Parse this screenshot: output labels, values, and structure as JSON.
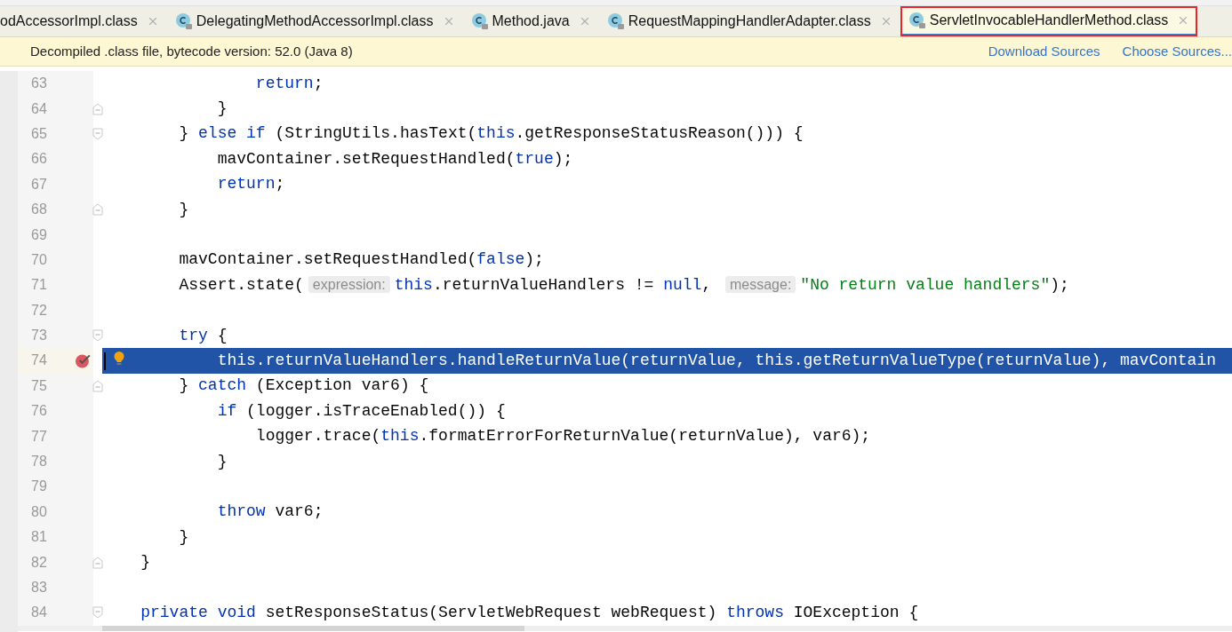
{
  "tabs": [
    {
      "label": "odAccessorImpl.class",
      "selected": false,
      "annotated": false,
      "icon": false
    },
    {
      "label": "DelegatingMethodAccessorImpl.class",
      "selected": false,
      "annotated": false,
      "icon": true
    },
    {
      "label": "Method.java",
      "selected": false,
      "annotated": false,
      "icon": true
    },
    {
      "label": "RequestMappingHandlerAdapter.class",
      "selected": false,
      "annotated": false,
      "icon": true
    },
    {
      "label": "ServletInvocableHandlerMethod.class",
      "selected": true,
      "annotated": true,
      "icon": true
    }
  ],
  "notification": {
    "message": "Decompiled .class file, bytecode version: 52.0 (Java 8)",
    "links": [
      "Download Sources",
      "Choose Sources..."
    ]
  },
  "lines": [
    {
      "number": "63",
      "selected": false,
      "breakpoint": false,
      "fold_start": false,
      "fold_end": false,
      "tokens": [
        {
          "kind": "keyword",
          "text": "                return"
        },
        {
          "kind": "plain",
          "text": ";"
        }
      ]
    },
    {
      "number": "64",
      "selected": false,
      "breakpoint": false,
      "fold_start": false,
      "fold_end": true,
      "tokens": [
        {
          "kind": "plain",
          "text": "            }"
        }
      ]
    },
    {
      "number": "65",
      "selected": false,
      "breakpoint": false,
      "fold_start": true,
      "fold_end": false,
      "tokens": [
        {
          "kind": "plain",
          "text": "        } "
        },
        {
          "kind": "keyword",
          "text": "else if"
        },
        {
          "kind": "plain",
          "text": " (StringUtils.hasText("
        },
        {
          "kind": "keyword",
          "text": "this"
        },
        {
          "kind": "plain",
          "text": ".getResponseStatusReason())) {"
        }
      ]
    },
    {
      "number": "66",
      "selected": false,
      "breakpoint": false,
      "fold_start": false,
      "fold_end": false,
      "tokens": [
        {
          "kind": "plain",
          "text": "            mavContainer.setRequestHandled("
        },
        {
          "kind": "keyword",
          "text": "true"
        },
        {
          "kind": "plain",
          "text": ");"
        }
      ]
    },
    {
      "number": "67",
      "selected": false,
      "breakpoint": false,
      "fold_start": false,
      "fold_end": false,
      "tokens": [
        {
          "kind": "keyword",
          "text": "            return"
        },
        {
          "kind": "plain",
          "text": ";"
        }
      ]
    },
    {
      "number": "68",
      "selected": false,
      "breakpoint": false,
      "fold_start": false,
      "fold_end": true,
      "tokens": [
        {
          "kind": "plain",
          "text": "        }"
        }
      ]
    },
    {
      "number": "69",
      "selected": false,
      "breakpoint": false,
      "fold_start": false,
      "fold_end": false
    },
    {
      "number": "70",
      "selected": false,
      "breakpoint": false,
      "fold_start": false,
      "fold_end": false,
      "tokens": [
        {
          "kind": "plain",
          "text": "        mavContainer.setRequestHandled("
        },
        {
          "kind": "keyword",
          "text": "false"
        },
        {
          "kind": "plain",
          "text": ");"
        }
      ]
    },
    {
      "number": "71",
      "selected": false,
      "breakpoint": false,
      "fold_start": false,
      "fold_end": false,
      "tokens": [
        {
          "kind": "plain",
          "text": "        Assert.state("
        },
        {
          "kind": "hint",
          "text": "expression:"
        },
        {
          "kind": "keyword",
          "text": "this"
        },
        {
          "kind": "plain",
          "text": ".returnValueHandlers != "
        },
        {
          "kind": "keyword",
          "text": "null"
        },
        {
          "kind": "plain",
          "text": ", "
        },
        {
          "kind": "hint",
          "text": "message:"
        },
        {
          "kind": "string",
          "text": "\"No return value handlers\""
        },
        {
          "kind": "plain",
          "text": ");"
        }
      ]
    },
    {
      "number": "72",
      "selected": false,
      "breakpoint": false,
      "fold_start": false,
      "fold_end": false
    },
    {
      "number": "73",
      "selected": false,
      "breakpoint": false,
      "fold_start": true,
      "fold_end": false,
      "tokens": [
        {
          "kind": "keyword",
          "text": "        try"
        },
        {
          "kind": "plain",
          "text": " {"
        }
      ]
    },
    {
      "number": "74",
      "selected": true,
      "breakpoint": true,
      "fold_start": false,
      "fold_end": false,
      "tokens": [
        {
          "kind": "plain",
          "text": "            this.returnValueHandlers.handleReturnValue(returnValue, this.getReturnValueType(returnValue), mavContain"
        }
      ]
    },
    {
      "number": "75",
      "selected": false,
      "breakpoint": false,
      "fold_start": false,
      "fold_end": true,
      "tokens": [
        {
          "kind": "plain",
          "text": "        } "
        },
        {
          "kind": "keyword",
          "text": "catch"
        },
        {
          "kind": "plain",
          "text": " (Exception var6) {"
        }
      ]
    },
    {
      "number": "76",
      "selected": false,
      "breakpoint": false,
      "fold_start": false,
      "fold_end": false,
      "tokens": [
        {
          "kind": "keyword",
          "text": "            if"
        },
        {
          "kind": "plain",
          "text": " (logger.isTraceEnabled()) {"
        }
      ]
    },
    {
      "number": "77",
      "selected": false,
      "breakpoint": false,
      "fold_start": false,
      "fold_end": false,
      "tokens": [
        {
          "kind": "plain",
          "text": "                logger.trace("
        },
        {
          "kind": "keyword",
          "text": "this"
        },
        {
          "kind": "plain",
          "text": ".formatErrorForReturnValue(returnValue), var6);"
        }
      ]
    },
    {
      "number": "78",
      "selected": false,
      "breakpoint": false,
      "fold_start": false,
      "fold_end": false,
      "tokens": [
        {
          "kind": "plain",
          "text": "            }"
        }
      ]
    },
    {
      "number": "79",
      "selected": false,
      "breakpoint": false,
      "fold_start": false,
      "fold_end": false
    },
    {
      "number": "80",
      "selected": false,
      "breakpoint": false,
      "fold_start": false,
      "fold_end": false,
      "tokens": [
        {
          "kind": "keyword",
          "text": "            throw"
        },
        {
          "kind": "plain",
          "text": " var6;"
        }
      ]
    },
    {
      "number": "81",
      "selected": false,
      "breakpoint": false,
      "fold_start": false,
      "fold_end": false,
      "tokens": [
        {
          "kind": "plain",
          "text": "        }"
        }
      ]
    },
    {
      "number": "82",
      "selected": false,
      "breakpoint": false,
      "fold_start": false,
      "fold_end": true,
      "tokens": [
        {
          "kind": "plain",
          "text": "    }"
        }
      ]
    },
    {
      "number": "83",
      "selected": false,
      "breakpoint": false,
      "fold_start": false,
      "fold_end": false
    },
    {
      "number": "84",
      "selected": false,
      "breakpoint": false,
      "fold_start": true,
      "fold_end": false,
      "tokens": [
        {
          "kind": "keyword",
          "text": "    private void"
        },
        {
          "kind": "plain",
          "text": " setResponseStatus(ServletWebRequest webRequest) "
        },
        {
          "kind": "keyword",
          "text": "throws"
        },
        {
          "kind": "plain",
          "text": " IOException {"
        }
      ]
    }
  ]
}
